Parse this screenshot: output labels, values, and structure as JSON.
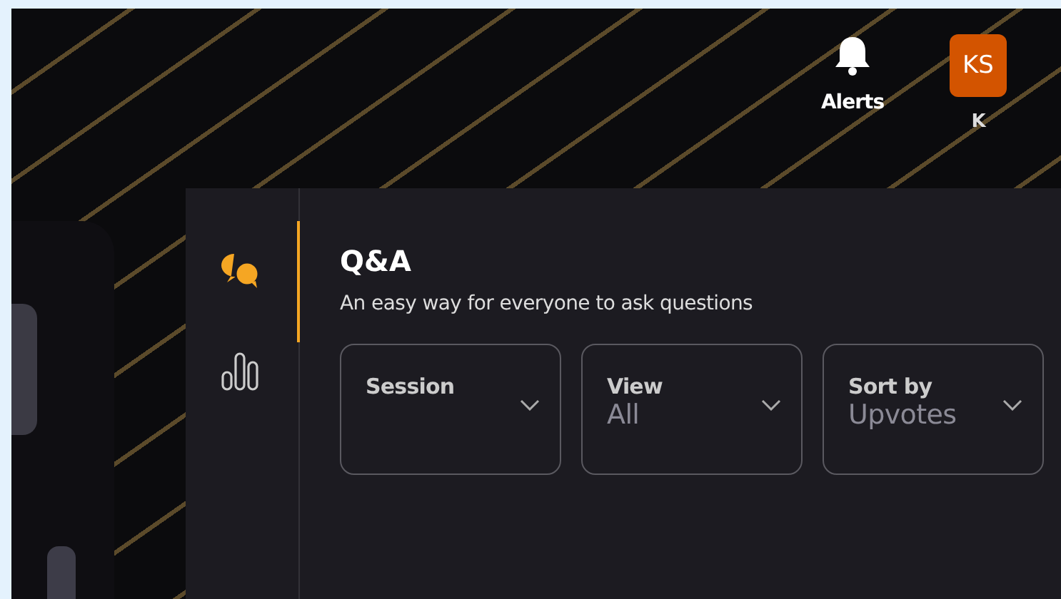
{
  "header": {
    "alerts": {
      "label": "Alerts"
    },
    "account": {
      "initials": "KS",
      "name": "K"
    }
  },
  "rail": [
    {
      "kind": "qa",
      "selected": true
    },
    {
      "kind": "chart",
      "selected": false
    }
  ],
  "panel": {
    "title": "Q&A",
    "subtitle": "An easy way for everyone to ask questions",
    "dropdowns": [
      {
        "label": "Session"
      },
      {
        "label": "View",
        "value": "All"
      },
      {
        "label": "Sort by",
        "value": "Upvotes"
      }
    ]
  }
}
